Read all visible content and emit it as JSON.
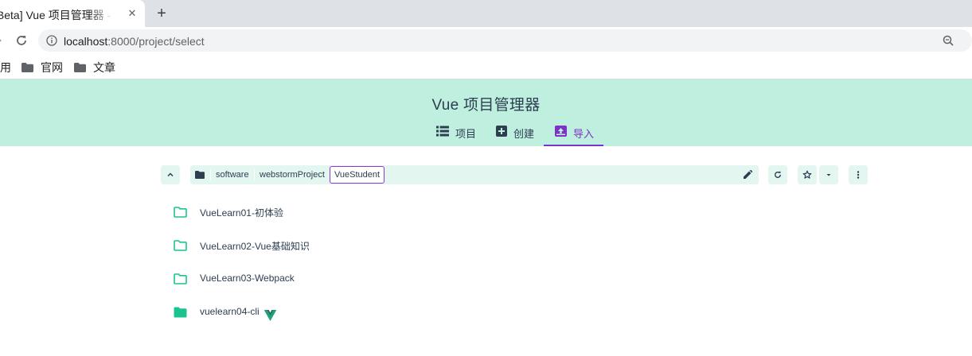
{
  "browser": {
    "tab_title": "[Beta] Vue 项目管理器 - Vue CLI",
    "close_glyph": "✕",
    "new_tab_glyph": "+",
    "url_host": "localhost",
    "url_rest": ":8000/project/select"
  },
  "bookmarks": [
    "用",
    "官网",
    "文章"
  ],
  "app": {
    "title": "Vue 项目管理器",
    "nav": [
      {
        "label": "项目",
        "icon": "list-icon"
      },
      {
        "label": "创建",
        "icon": "plus-box-icon"
      },
      {
        "label": "导入",
        "icon": "import-icon",
        "active": true
      }
    ],
    "accent": "#7d31c6",
    "header_bg": "#bfefdf",
    "folder_color": "#1bc48f"
  },
  "path": {
    "segments": [
      "software",
      "webstormProject"
    ],
    "current": "VueStudent"
  },
  "folders": [
    {
      "name": "VueLearn01-初体验",
      "open": false
    },
    {
      "name": "VueLearn02-Vue基础知识",
      "open": false
    },
    {
      "name": "VueLearn03-Webpack",
      "open": false
    },
    {
      "name": "vuelearn04-cli",
      "open": true,
      "vue_project": true
    }
  ]
}
